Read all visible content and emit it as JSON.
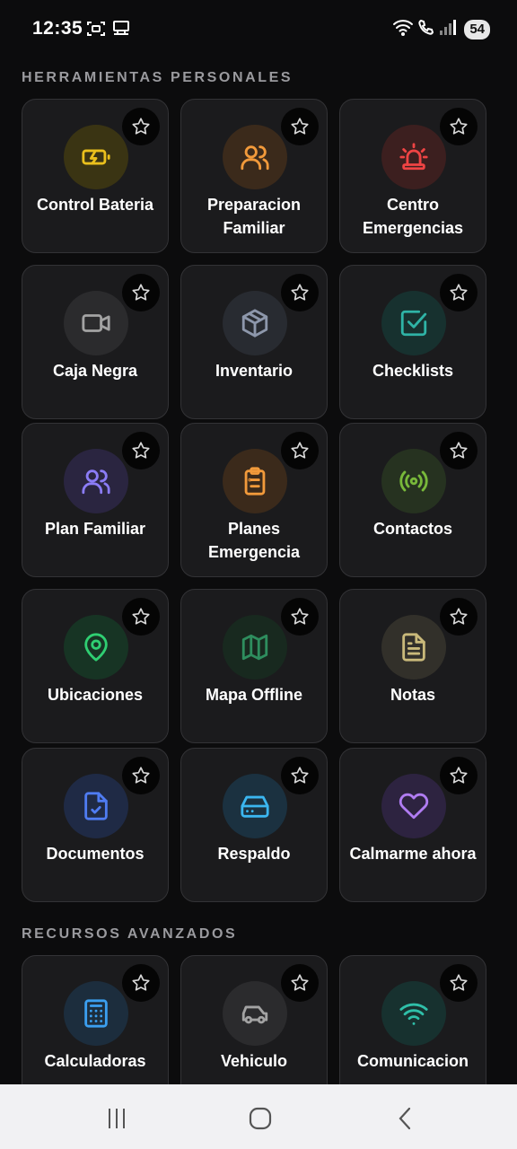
{
  "status_bar": {
    "time": "12:35",
    "battery": "54"
  },
  "sections": [
    {
      "title": "HERRAMIENTAS PERSONALES",
      "items": [
        {
          "label": "Control Bateria",
          "icon": "battery-charging-icon",
          "color": "#eac01d",
          "bg": "#3a3413"
        },
        {
          "label": "Preparacion Familiar",
          "icon": "users-icon",
          "color": "#f29a3b",
          "bg": "#3b2a1b"
        },
        {
          "label": "Centro Emergencias",
          "icon": "siren-icon",
          "color": "#ef4444",
          "bg": "#3c1f1f"
        },
        {
          "label": "Caja Negra",
          "icon": "video-icon",
          "color": "#a3a3a3",
          "bg": "#2b2b2d"
        },
        {
          "label": "Inventario",
          "icon": "package-icon",
          "color": "#8d97ab",
          "bg": "#282b31"
        },
        {
          "label": "Checklists",
          "icon": "check-square-icon",
          "color": "#2fb3a6",
          "bg": "#17312f"
        },
        {
          "label": "Plan Familiar",
          "icon": "users-icon",
          "color": "#8b7cf6",
          "bg": "#2a2540"
        },
        {
          "label": "Planes Emergencia",
          "icon": "clipboard-list-icon",
          "color": "#f29a3b",
          "bg": "#3b2a1b"
        },
        {
          "label": "Contactos",
          "icon": "radio-icon",
          "color": "#78b83a",
          "bg": "#263220"
        },
        {
          "label": "Ubicaciones",
          "icon": "map-pin-icon",
          "color": "#2fcf72",
          "bg": "#173424"
        },
        {
          "label": "Mapa Offline",
          "icon": "map-icon",
          "color": "#2e8d5e",
          "bg": "#18291f"
        },
        {
          "label": "Notas",
          "icon": "file-text-icon",
          "color": "#c9b97a",
          "bg": "#32302a"
        },
        {
          "label": "Documentos",
          "icon": "file-check-icon",
          "color": "#4f7cf2",
          "bg": "#1f2a45"
        },
        {
          "label": "Respaldo",
          "icon": "hard-drive-icon",
          "color": "#3bb6f0",
          "bg": "#1b3140"
        },
        {
          "label": "Calmarme ahora",
          "icon": "heart-icon",
          "color": "#b07cf2",
          "bg": "#2d2340"
        }
      ]
    },
    {
      "title": "RECURSOS AVANZADOS",
      "items": [
        {
          "label": "Calculadoras",
          "icon": "calculator-icon",
          "color": "#3b9ff0",
          "bg": "#1c2d3d"
        },
        {
          "label": "Vehiculo",
          "icon": "car-icon",
          "color": "#a3a3a3",
          "bg": "#2b2b2d"
        },
        {
          "label": "Comunicacion",
          "icon": "wifi-icon",
          "color": "#2fbfa9",
          "bg": "#17312f"
        }
      ]
    }
  ]
}
